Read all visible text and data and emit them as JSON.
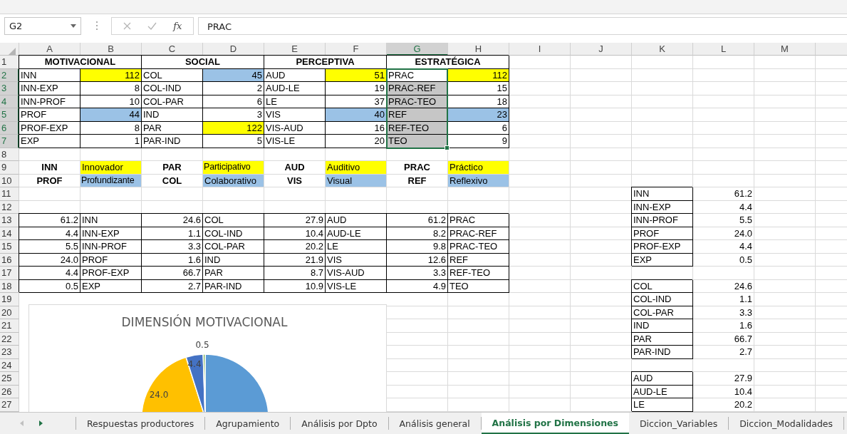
{
  "name_box": "G2",
  "formula_bar": {
    "function_label": "fx",
    "value": "PRAC"
  },
  "columns": [
    {
      "label": "A",
      "selected": false
    },
    {
      "label": "B",
      "selected": false
    },
    {
      "label": "C",
      "selected": false
    },
    {
      "label": "D",
      "selected": false
    },
    {
      "label": "E",
      "selected": false
    },
    {
      "label": "F",
      "selected": false
    },
    {
      "label": "G",
      "selected": true
    },
    {
      "label": "H",
      "selected": false
    },
    {
      "label": "I",
      "selected": false
    },
    {
      "label": "J",
      "selected": false
    },
    {
      "label": "K",
      "selected": false
    },
    {
      "label": "L",
      "selected": false
    },
    {
      "label": "M",
      "selected": false
    }
  ],
  "rows": [
    {
      "number": "1",
      "selected": false,
      "cells": [
        {
          "text": "MOTIVACIONAL",
          "kind": "heading",
          "border": true,
          "merged": true
        },
        null,
        {
          "text": "SOCIAL",
          "kind": "heading",
          "border": true,
          "merged": true
        },
        null,
        {
          "text": "PERCEPTIVA",
          "kind": "heading",
          "border": true,
          "merged": true
        },
        null,
        {
          "text": "ESTRATÉGICA",
          "kind": "heading",
          "border": true,
          "merged": true
        }
      ]
    },
    {
      "number": "2",
      "selected": true,
      "cells": [
        {
          "text": "INN",
          "kind": "text",
          "border": true
        },
        {
          "text": "112",
          "kind": "number",
          "border": true,
          "color": "#ffff00"
        },
        {
          "text": "COL",
          "kind": "text",
          "border": true
        },
        {
          "text": "45",
          "kind": "number",
          "border": true,
          "color": "#9bc2e6"
        },
        {
          "text": "AUD",
          "kind": "text",
          "border": true
        },
        {
          "text": "51",
          "kind": "number",
          "border": true,
          "color": "#ffff00"
        },
        {
          "text": "PRAC",
          "kind": "text",
          "border": true
        },
        {
          "text": "112",
          "kind": "number",
          "border": true,
          "color": "#ffff00"
        }
      ]
    },
    {
      "number": "3",
      "selected": true,
      "cells": [
        {
          "text": "INN-EXP",
          "kind": "text",
          "border": true
        },
        {
          "text": "8",
          "kind": "number",
          "border": true
        },
        {
          "text": "COL-IND",
          "kind": "text",
          "border": true
        },
        {
          "text": "2",
          "kind": "number",
          "border": true
        },
        {
          "text": "AUD-LE",
          "kind": "text",
          "border": true
        },
        {
          "text": "19",
          "kind": "number",
          "border": true
        },
        {
          "text": "PRAC-REF",
          "kind": "text",
          "border": true
        },
        {
          "text": "15",
          "kind": "number",
          "border": true
        }
      ]
    },
    {
      "number": "4",
      "selected": true,
      "cells": [
        {
          "text": "INN-PROF",
          "kind": "text",
          "border": true
        },
        {
          "text": "10",
          "kind": "number",
          "border": true
        },
        {
          "text": "COL-PAR",
          "kind": "text",
          "border": true
        },
        {
          "text": "6",
          "kind": "number",
          "border": true
        },
        {
          "text": "LE",
          "kind": "text",
          "border": true
        },
        {
          "text": "37",
          "kind": "number",
          "border": true
        },
        {
          "text": "PRAC-TEO",
          "kind": "text",
          "border": true
        },
        {
          "text": "18",
          "kind": "number",
          "border": true
        }
      ]
    },
    {
      "number": "5",
      "selected": true,
      "cells": [
        {
          "text": "PROF",
          "kind": "text",
          "border": true
        },
        {
          "text": "44",
          "kind": "number",
          "border": true,
          "color": "#9bc2e6"
        },
        {
          "text": "IND",
          "kind": "text",
          "border": true
        },
        {
          "text": "3",
          "kind": "number",
          "border": true
        },
        {
          "text": "VIS",
          "kind": "text",
          "border": true
        },
        {
          "text": "40",
          "kind": "number",
          "border": true,
          "color": "#9bc2e6"
        },
        {
          "text": "REF",
          "kind": "text",
          "border": true
        },
        {
          "text": "23",
          "kind": "number",
          "border": true,
          "color": "#9bc2e6"
        }
      ]
    },
    {
      "number": "6",
      "selected": true,
      "cells": [
        {
          "text": "PROF-EXP",
          "kind": "text",
          "border": true
        },
        {
          "text": "8",
          "kind": "number",
          "border": true
        },
        {
          "text": "PAR",
          "kind": "text",
          "border": true
        },
        {
          "text": "122",
          "kind": "number",
          "border": true,
          "color": "#ffff00"
        },
        {
          "text": "VIS-AUD",
          "kind": "text",
          "border": true
        },
        {
          "text": "16",
          "kind": "number",
          "border": true
        },
        {
          "text": "REF-TEO",
          "kind": "text",
          "border": true
        },
        {
          "text": "6",
          "kind": "number",
          "border": true
        }
      ]
    },
    {
      "number": "7",
      "selected": true,
      "cells": [
        {
          "text": "EXP",
          "kind": "text",
          "border": true
        },
        {
          "text": "1",
          "kind": "number",
          "border": true
        },
        {
          "text": "PAR-IND",
          "kind": "text",
          "border": true
        },
        {
          "text": "5",
          "kind": "number",
          "border": true
        },
        {
          "text": "VIS-LE",
          "kind": "text",
          "border": true
        },
        {
          "text": "20",
          "kind": "number",
          "border": true
        },
        {
          "text": "TEO",
          "kind": "text",
          "border": true
        },
        {
          "text": "9",
          "kind": "number",
          "border": true
        }
      ]
    },
    {
      "number": "8",
      "selected": false
    },
    {
      "number": "9",
      "selected": false,
      "cells": [
        {
          "text": "INN",
          "kind": "heading"
        },
        {
          "text": "Innovador",
          "kind": "text",
          "color": "#ffff00"
        },
        {
          "text": "PAR",
          "kind": "heading"
        },
        {
          "text": "Participativo",
          "kind": "text",
          "color": "#ffff00"
        },
        {
          "text": "AUD",
          "kind": "heading"
        },
        {
          "text": "Auditivo",
          "kind": "text",
          "color": "#ffff00"
        },
        {
          "text": "PRAC",
          "kind": "heading"
        },
        {
          "text": "Práctico",
          "kind": "text",
          "color": "#ffff00"
        }
      ]
    },
    {
      "number": "10",
      "selected": false,
      "cells": [
        {
          "text": "PROF",
          "kind": "heading"
        },
        {
          "text": "Profundizante",
          "kind": "text",
          "color": "#9bc2e6"
        },
        {
          "text": "COL",
          "kind": "heading"
        },
        {
          "text": "Colaborativo",
          "kind": "text",
          "color": "#9bc2e6"
        },
        {
          "text": "VIS",
          "kind": "heading"
        },
        {
          "text": "Visual",
          "kind": "text",
          "color": "#9bc2e6"
        },
        {
          "text": "REF",
          "kind": "heading"
        },
        {
          "text": "Reflexivo",
          "kind": "text",
          "color": "#9bc2e6"
        }
      ]
    },
    {
      "number": "11",
      "selected": false,
      "cells": [
        null,
        null,
        null,
        null,
        null,
        null,
        null,
        null,
        null,
        null,
        {
          "text": "INN",
          "kind": "text",
          "border": true
        },
        {
          "text": "61.2",
          "kind": "number"
        }
      ]
    },
    {
      "number": "12",
      "selected": false,
      "cells": [
        null,
        null,
        null,
        null,
        null,
        null,
        null,
        null,
        null,
        null,
        {
          "text": "INN-EXP",
          "kind": "text",
          "border": true
        },
        {
          "text": "4.4",
          "kind": "number"
        }
      ]
    },
    {
      "number": "13",
      "selected": false,
      "cells": [
        {
          "text": "61.2",
          "kind": "number",
          "border": true
        },
        {
          "text": "INN",
          "kind": "text",
          "border": true
        },
        {
          "text": "24.6",
          "kind": "number",
          "border": true
        },
        {
          "text": "COL",
          "kind": "text",
          "border": true
        },
        {
          "text": "27.9",
          "kind": "number",
          "border": true
        },
        {
          "text": "AUD",
          "kind": "text",
          "border": true
        },
        {
          "text": "61.2",
          "kind": "number",
          "border": true
        },
        {
          "text": "PRAC",
          "kind": "text",
          "border": true
        },
        null,
        null,
        {
          "text": "INN-PROF",
          "kind": "text",
          "border": true
        },
        {
          "text": "5.5",
          "kind": "number"
        }
      ]
    },
    {
      "number": "14",
      "selected": false,
      "cells": [
        {
          "text": "4.4",
          "kind": "number",
          "border": true
        },
        {
          "text": "INN-EXP",
          "kind": "text",
          "border": true
        },
        {
          "text": "1.1",
          "kind": "number",
          "border": true
        },
        {
          "text": "COL-IND",
          "kind": "text",
          "border": true
        },
        {
          "text": "10.4",
          "kind": "number",
          "border": true
        },
        {
          "text": "AUD-LE",
          "kind": "text",
          "border": true
        },
        {
          "text": "8.2",
          "kind": "number",
          "border": true
        },
        {
          "text": "PRAC-REF",
          "kind": "text",
          "border": true
        },
        null,
        null,
        {
          "text": "PROF",
          "kind": "text",
          "border": true
        },
        {
          "text": "24.0",
          "kind": "number"
        }
      ]
    },
    {
      "number": "15",
      "selected": false,
      "cells": [
        {
          "text": "5.5",
          "kind": "number",
          "border": true
        },
        {
          "text": "INN-PROF",
          "kind": "text",
          "border": true
        },
        {
          "text": "3.3",
          "kind": "number",
          "border": true
        },
        {
          "text": "COL-PAR",
          "kind": "text",
          "border": true
        },
        {
          "text": "20.2",
          "kind": "number",
          "border": true
        },
        {
          "text": "LE",
          "kind": "text",
          "border": true
        },
        {
          "text": "9.8",
          "kind": "number",
          "border": true
        },
        {
          "text": "PRAC-TEO",
          "kind": "text",
          "border": true
        },
        null,
        null,
        {
          "text": "PROF-EXP",
          "kind": "text",
          "border": true
        },
        {
          "text": "4.4",
          "kind": "number"
        }
      ]
    },
    {
      "number": "16",
      "selected": false,
      "cells": [
        {
          "text": "24.0",
          "kind": "number",
          "border": true
        },
        {
          "text": "PROF",
          "kind": "text",
          "border": true
        },
        {
          "text": "1.6",
          "kind": "number",
          "border": true
        },
        {
          "text": "IND",
          "kind": "text",
          "border": true
        },
        {
          "text": "21.9",
          "kind": "number",
          "border": true
        },
        {
          "text": "VIS",
          "kind": "text",
          "border": true
        },
        {
          "text": "12.6",
          "kind": "number",
          "border": true
        },
        {
          "text": "REF",
          "kind": "text",
          "border": true
        },
        null,
        null,
        {
          "text": "EXP",
          "kind": "text",
          "border": true
        },
        {
          "text": "0.5",
          "kind": "number"
        }
      ]
    },
    {
      "number": "17",
      "selected": false,
      "cells": [
        {
          "text": "4.4",
          "kind": "number",
          "border": true
        },
        {
          "text": "PROF-EXP",
          "kind": "text",
          "border": true
        },
        {
          "text": "66.7",
          "kind": "number",
          "border": true
        },
        {
          "text": "PAR",
          "kind": "text",
          "border": true
        },
        {
          "text": "8.7",
          "kind": "number",
          "border": true
        },
        {
          "text": "VIS-AUD",
          "kind": "text",
          "border": true
        },
        {
          "text": "3.3",
          "kind": "number",
          "border": true
        },
        {
          "text": "REF-TEO",
          "kind": "text",
          "border": true
        }
      ]
    },
    {
      "number": "18",
      "selected": false,
      "cells": [
        {
          "text": "0.5",
          "kind": "number",
          "border": true
        },
        {
          "text": "EXP",
          "kind": "text",
          "border": true
        },
        {
          "text": "2.7",
          "kind": "number",
          "border": true
        },
        {
          "text": "PAR-IND",
          "kind": "text",
          "border": true
        },
        {
          "text": "10.9",
          "kind": "number",
          "border": true
        },
        {
          "text": "VIS-LE",
          "kind": "text",
          "border": true
        },
        {
          "text": "4.9",
          "kind": "number",
          "border": true
        },
        {
          "text": "TEO",
          "kind": "text",
          "border": true
        },
        null,
        null,
        {
          "text": "COL",
          "kind": "text",
          "border": true
        },
        {
          "text": "24.6",
          "kind": "number"
        }
      ]
    },
    {
      "number": "19",
      "selected": false,
      "cells": [
        null,
        null,
        null,
        null,
        null,
        null,
        null,
        null,
        null,
        null,
        {
          "text": "COL-IND",
          "kind": "text",
          "border": true
        },
        {
          "text": "1.1",
          "kind": "number"
        }
      ]
    },
    {
      "number": "20",
      "selected": false,
      "cells": [
        null,
        null,
        null,
        null,
        null,
        null,
        null,
        null,
        null,
        null,
        {
          "text": "COL-PAR",
          "kind": "text",
          "border": true
        },
        {
          "text": "3.3",
          "kind": "number"
        }
      ]
    },
    {
      "number": "21",
      "selected": false,
      "cells": [
        null,
        null,
        null,
        null,
        null,
        null,
        null,
        null,
        null,
        null,
        {
          "text": "IND",
          "kind": "text",
          "border": true
        },
        {
          "text": "1.6",
          "kind": "number"
        }
      ]
    },
    {
      "number": "22",
      "selected": false,
      "cells": [
        null,
        null,
        null,
        null,
        null,
        null,
        null,
        null,
        null,
        null,
        {
          "text": "PAR",
          "kind": "text",
          "border": true
        },
        {
          "text": "66.7",
          "kind": "number"
        }
      ]
    },
    {
      "number": "23",
      "selected": false,
      "cells": [
        null,
        null,
        null,
        null,
        null,
        null,
        null,
        null,
        null,
        null,
        {
          "text": "PAR-IND",
          "kind": "text",
          "border": true
        },
        {
          "text": "2.7",
          "kind": "number"
        }
      ]
    },
    {
      "number": "24",
      "selected": false
    },
    {
      "number": "25",
      "selected": false,
      "cells": [
        null,
        null,
        null,
        null,
        null,
        null,
        null,
        null,
        null,
        null,
        {
          "text": "AUD",
          "kind": "text",
          "border": true
        },
        {
          "text": "27.9",
          "kind": "number"
        }
      ]
    },
    {
      "number": "26",
      "selected": false,
      "cells": [
        null,
        null,
        null,
        null,
        null,
        null,
        null,
        null,
        null,
        null,
        {
          "text": "AUD-LE",
          "kind": "text",
          "border": true
        },
        {
          "text": "10.4",
          "kind": "number"
        }
      ]
    },
    {
      "number": "27",
      "selected": false,
      "cells": [
        null,
        null,
        null,
        null,
        null,
        null,
        null,
        null,
        null,
        null,
        {
          "text": "LE",
          "kind": "text",
          "border": true
        },
        {
          "text": "20.2",
          "kind": "number"
        }
      ]
    }
  ],
  "chart": {
    "title": "DIMENSIÓN MOTIVACIONAL",
    "slice_labels": [
      "0.5",
      "4.4",
      "24.0"
    ]
  },
  "sheet_tabs": [
    {
      "label": "Respuestas productores",
      "selected": false
    },
    {
      "label": "Agrupamiento",
      "selected": false
    },
    {
      "label": "Análisis por Dpto",
      "selected": false
    },
    {
      "label": "Análisis general",
      "selected": false
    },
    {
      "label": "Análisis por Dimensiones",
      "selected": true
    },
    {
      "label": "Diccion_Variables",
      "selected": false
    },
    {
      "label": "Diccion_Modalidades",
      "selected": false
    }
  ]
}
